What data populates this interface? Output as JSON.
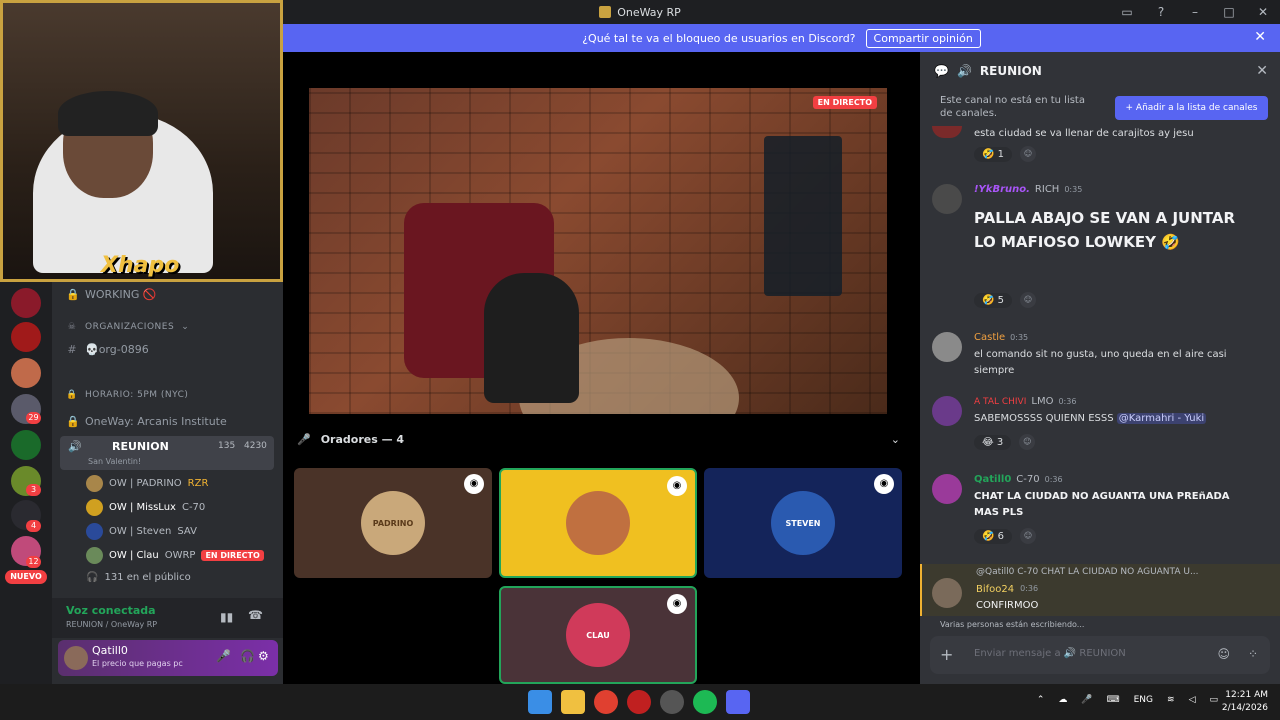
{
  "window": {
    "title": "OneWay RP"
  },
  "notice": {
    "text": "¿Qué tal te va el bloqueo de usuarios en Discord?",
    "button": "Compartir opinión"
  },
  "webcam": {
    "streamer_name": "Xhapo"
  },
  "servers": {
    "badges": [
      "29",
      "4",
      "3",
      "4",
      "12"
    ],
    "new_label": "NUEVO"
  },
  "sidebar": {
    "channels": [
      {
        "label": "WORKING 🚫",
        "icon": "lock"
      },
      {
        "label": "ORGANIZACIONES",
        "icon": "skull",
        "category": true
      },
      {
        "label": "💀org-0896",
        "icon": "hash"
      },
      {
        "label": "HORARIO: 5PM (NYC)",
        "icon": "lock"
      },
      {
        "label": "OneWay: Arcanis Institute",
        "icon": "lock"
      }
    ],
    "active_voice": {
      "name": "REUNION",
      "subtitle": "San Valentin!",
      "count": "135",
      "limit": "4230"
    },
    "members": [
      {
        "name": "OW | PADRINO",
        "tag": "RZR"
      },
      {
        "name": "OW | MissLux",
        "tag": "C-70"
      },
      {
        "name": "OW | Steven",
        "tag": "SAV"
      },
      {
        "name": "OW | Clau",
        "tag": "OWRP",
        "live": "EN DIRECTO"
      }
    ],
    "audience": "131 en el público"
  },
  "voicebar": {
    "status": "Voz conectada",
    "channel": "REUNION / OneWay RP"
  },
  "userbar": {
    "username": "Qatill0",
    "status": "El precio que pagas pc"
  },
  "stage": {
    "live_label": "EN DIRECTO",
    "speakers_header": "Oradores — 4",
    "tiles": [
      {
        "label": "PADRINO",
        "bg": "#4a3328"
      },
      {
        "label": "",
        "bg": "#f0c020"
      },
      {
        "label": "STEVEN",
        "bg": "#14245a"
      },
      {
        "label": "CLAU",
        "bg": "#4a3338"
      }
    ]
  },
  "chat": {
    "channel": "REUNION",
    "notice": "Este canal no está en tu lista de canales.",
    "add_button": "+ Añadir a la lista de canales",
    "messages": [
      {
        "author": "",
        "time": "",
        "text": "esta ciudad se va llenar de carajitos ay jesu",
        "reaction": "🤣 1"
      },
      {
        "author": "!YkBruno.",
        "tag": "RICH",
        "time": "0:35",
        "text": "PALLA ABAJO SE VAN A JUNTAR LO MAFIOSO LOWKEY 🤣",
        "reaction": "🤣 5",
        "big": true
      },
      {
        "author": "Castle",
        "time": "0:35",
        "text": "el comando sit no gusta, uno queda en el aire casi siempre"
      },
      {
        "author": "A TAL CHIVI",
        "tag": "LMO",
        "time": "0:36",
        "text": "SABEMOSSSS QUIENN ESSS",
        "mention": "@Karmahri - Yuki",
        "reaction": "😂 3"
      },
      {
        "author": "Qatill0",
        "tag": "C-70",
        "time": "0:36",
        "text": "CHAT LA CIUDAD NO AGUANTA UNA PREñADA MAS PLS",
        "reaction": "🤣 6"
      }
    ],
    "reply_preview": "@Qatill0 C-70 CHAT LA CIUDAD NO AGUANTA U...",
    "reply_author": "Bifoo24",
    "reply_time": "0:36",
    "reply_text": "CONFIRMOO",
    "typing": "Varias personas están escribiendo...",
    "composer_placeholder": "Enviar mensaje a 🔊 REUNION"
  },
  "taskbar": {
    "lang": "ENG",
    "time": "12:21 AM",
    "date": "2/14/2026"
  },
  "colors": {
    "accent": "#5865f2",
    "live": "#f23f42",
    "voice": "#23a55a"
  }
}
